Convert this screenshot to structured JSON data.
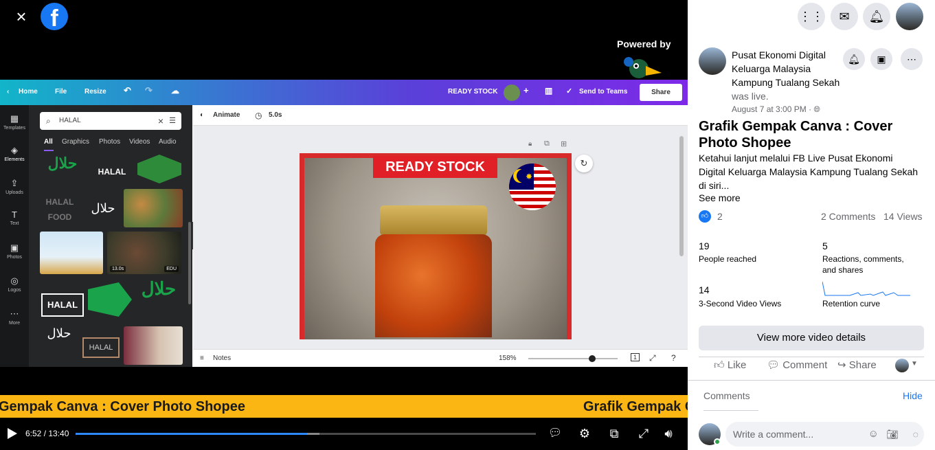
{
  "viewer": {
    "close_icon": "×",
    "fb_letter": "f",
    "powered_by": "Powered by",
    "streamyard_text": "StreamYard"
  },
  "canva": {
    "topbar": {
      "home": "Home",
      "file": "File",
      "resize": "Resize",
      "ready_stock": "READY STOCK",
      "send_to": "Send to Teams",
      "share": "Share"
    },
    "rail": [
      "Templates",
      "Elements",
      "Uploads",
      "Text",
      "Photos",
      "Logos",
      "More"
    ],
    "search_value": "HALAL",
    "tabs": [
      "All",
      "Graphics",
      "Photos",
      "Videos",
      "Audio"
    ],
    "thumb_labels": {
      "halal": "HALAL",
      "halal_food": "HALAL FOOD",
      "video_time": "13.0s",
      "edu": "EDU"
    },
    "toolbar": {
      "animate": "Animate",
      "duration": "5.0s"
    },
    "bottom": {
      "notes": "Notes",
      "zoom": "158%",
      "page": "1"
    },
    "design_text": "READY STOCK"
  },
  "ticker": {
    "text_a": "Gempak Canva : Cover Photo Shopee",
    "text_b": "Grafik Gempak C"
  },
  "player": {
    "time": "6:52 / 13:40",
    "progress": 0.5025
  },
  "sidebar": {
    "page_name": "Pusat Ekonomi Digital Keluarga Malaysia Kampung Tualang Sekah",
    "was_live": "was live.",
    "date": "August 7 at 3:00 PM · ",
    "post_title": "Grafik Gempak Canva : Cover Photo Shopee",
    "description": "Ketahui lanjut melalui FB Live Pusat Ekonomi Digital Keluarga Malaysia Kampung Tualang Sekah di siri...",
    "see_more": "See more",
    "like_count": "2",
    "comments_count": "2 Comments",
    "views_count": "14 Views",
    "stats": {
      "reached_num": "19",
      "reached_lbl": "People reached",
      "reactions_num": "5",
      "reactions_lbl": "Reactions, comments, and shares",
      "views3_num": "14",
      "views3_lbl": "3-Second Video Views",
      "retention_lbl": "Retention curve"
    },
    "more_details": "View more video details",
    "actions": {
      "like": "Like",
      "comment": "Comment",
      "share": "Share"
    },
    "comments_label": "Comments",
    "hide": "Hide",
    "comment_placeholder": "Write a comment..."
  },
  "colors": {
    "fb_blue": "#1877f2",
    "ticker_bg": "#fcb614",
    "progress": "#2d88ff"
  },
  "icons": [
    "close-icon",
    "facebook-icon",
    "menu-grid-icon",
    "messenger-icon",
    "bell-icon",
    "play-icon",
    "settings-icon",
    "fullscreen-icon",
    "volume-icon"
  ]
}
